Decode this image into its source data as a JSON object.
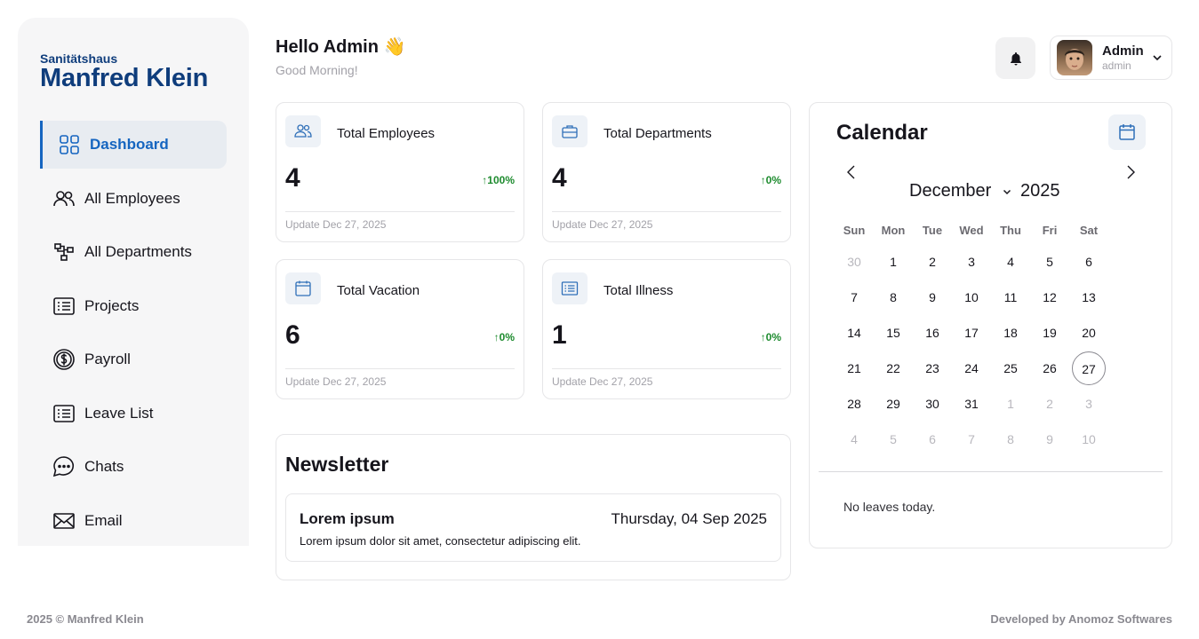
{
  "brand": {
    "line1": "Sanitätshaus",
    "line2": "Manfred Klein"
  },
  "sidebar": {
    "items": [
      {
        "label": "Dashboard",
        "icon": "grid-icon"
      },
      {
        "label": "All Employees",
        "icon": "users-icon"
      },
      {
        "label": "All Departments",
        "icon": "hierarchy-icon"
      },
      {
        "label": "Projects",
        "icon": "list-icon"
      },
      {
        "label": "Payroll",
        "icon": "dollar-icon"
      },
      {
        "label": "Leave List",
        "icon": "list-icon"
      },
      {
        "label": "Chats",
        "icon": "chat-icon"
      },
      {
        "label": "Email",
        "icon": "mail-icon"
      }
    ],
    "active_index": 0
  },
  "header": {
    "title": "Hello Admin 👋",
    "subtitle": "Good Morning!"
  },
  "profile": {
    "name": "Admin",
    "role": "admin"
  },
  "stats": [
    {
      "label": "Total Employees",
      "value": "4",
      "change": "↑100%",
      "updated": "Update Dec 27, 2025",
      "icon": "users-icon"
    },
    {
      "label": "Total Departments",
      "value": "4",
      "change": "↑0%",
      "updated": "Update Dec 27, 2025",
      "icon": "briefcase-icon"
    },
    {
      "label": "Total Vacation",
      "value": "6",
      "change": "↑0%",
      "updated": "Update Dec 27, 2025",
      "icon": "calendar-icon"
    },
    {
      "label": "Total Illness",
      "value": "1",
      "change": "↑0%",
      "updated": "Update Dec 27, 2025",
      "icon": "list-icon"
    }
  ],
  "newsletter": {
    "title": "Newsletter",
    "item": {
      "heading": "Lorem ipsum",
      "date": "Thursday, 04 Sep 2025",
      "text": "Lorem ipsum dolor sit amet, consectetur adipiscing elit."
    }
  },
  "calendar": {
    "title": "Calendar",
    "month": "December",
    "year": "2025",
    "weekdays": [
      "Sun",
      "Mon",
      "Tue",
      "Wed",
      "Thu",
      "Fri",
      "Sat"
    ],
    "days": [
      "30",
      "1",
      "2",
      "3",
      "4",
      "5",
      "6",
      "7",
      "8",
      "9",
      "10",
      "11",
      "12",
      "13",
      "14",
      "15",
      "16",
      "17",
      "18",
      "19",
      "20",
      "21",
      "22",
      "23",
      "24",
      "25",
      "26",
      "27",
      "28",
      "29",
      "30",
      "31",
      "1",
      "2",
      "3",
      "4",
      "5",
      "6",
      "7",
      "8",
      "9",
      "10"
    ],
    "outside": [
      0,
      32,
      33,
      34,
      35,
      36,
      37,
      38,
      39,
      40,
      41
    ],
    "today_index": 27,
    "empty_text": "No leaves today."
  },
  "footer": {
    "left": "2025  © Manfred Klein",
    "right": "Developed by Anomoz Softwares"
  },
  "colors": {
    "accent": "#1565c0",
    "positive": "#1d8b2e",
    "muted": "#a2a1a8"
  }
}
